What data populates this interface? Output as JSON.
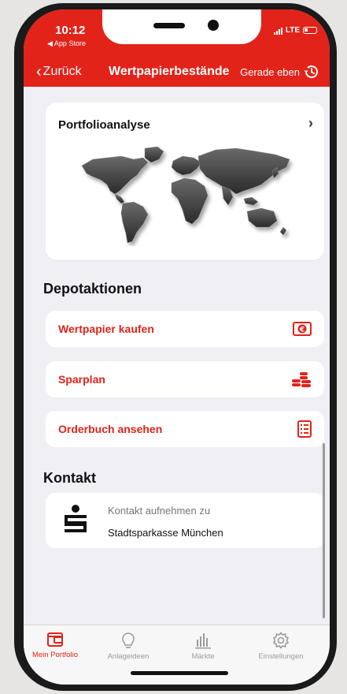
{
  "status": {
    "time": "10:12",
    "back_app": "◀ App Store",
    "network": "LTE"
  },
  "nav": {
    "back_label": "Zurück",
    "title": "Wertpapierbestände",
    "refresh_label": "Gerade eben"
  },
  "portfolio": {
    "title": "Portfolioanalyse"
  },
  "depot": {
    "title": "Depotaktionen",
    "actions": [
      {
        "label": "Wertpapier kaufen",
        "icon": "euro-banknote-icon"
      },
      {
        "label": "Sparplan",
        "icon": "coin-stack-icon"
      },
      {
        "label": "Orderbuch ansehen",
        "icon": "document-list-icon"
      }
    ]
  },
  "contact": {
    "title": "Kontakt",
    "line1": "Kontakt aufnehmen zu",
    "line2": "Stadtsparkasse München"
  },
  "tabs": [
    {
      "label": "Mein Portfolio",
      "icon": "wallet-icon",
      "active": true
    },
    {
      "label": "Anlageideen",
      "icon": "lightbulb-icon",
      "active": false
    },
    {
      "label": "Märkte",
      "icon": "bar-chart-icon",
      "active": false
    },
    {
      "label": "Einstellungen",
      "icon": "gear-icon",
      "active": false
    }
  ],
  "colors": {
    "accent": "#e2231a",
    "background": "#efeff4"
  }
}
